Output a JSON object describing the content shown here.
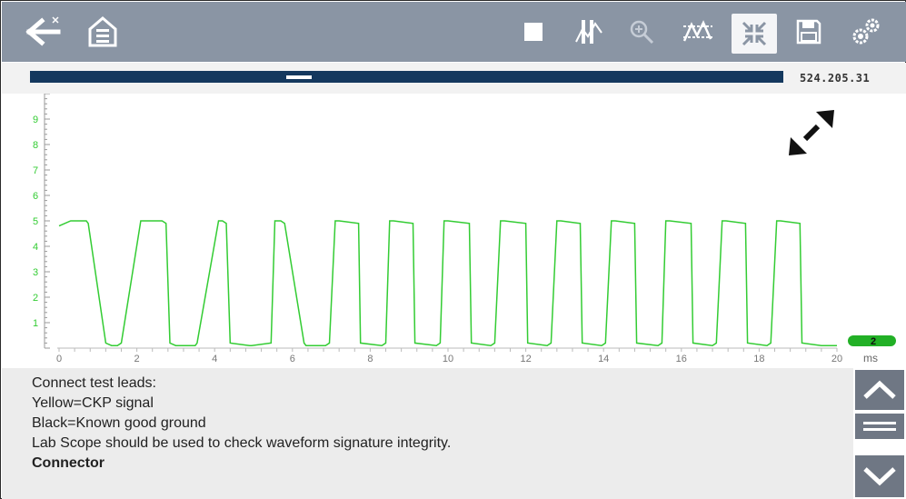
{
  "toolbar": {
    "back_icon": "back-arrow-icon",
    "home_icon": "home-icon",
    "stop_icon": "stop-icon",
    "pause_icon": "pause-trace-icon",
    "zoom_icon": "zoom-icon",
    "trace_settings_icon": "trace-settings-icon",
    "fullscreen_icon": "collapse-arrows-icon",
    "save_icon": "save-icon",
    "settings_icon": "gears-icon"
  },
  "position_bar": {
    "readout": "524.205.31"
  },
  "graph": {
    "expand_icon": "expand-arrows-icon",
    "trace_badge": "2",
    "x_unit": "ms",
    "trace_color": "#33cc33"
  },
  "chart_data": {
    "type": "line",
    "series": [
      {
        "x": [
          0,
          0.3,
          0.7,
          0.75,
          1.2,
          1.35,
          1.5,
          1.6,
          2.1,
          2.15,
          2.65,
          2.75,
          2.85,
          3.0,
          3.5,
          3.55,
          4.1,
          4.2,
          4.3,
          4.4,
          4.9,
          4.95,
          5.45,
          5.55,
          5.7,
          5.8,
          6.3,
          6.35,
          6.85,
          6.95,
          7.1,
          7.2,
          7.7,
          7.75,
          8.3,
          8.4,
          8.5,
          8.6,
          9.1,
          9.15,
          9.7,
          9.8,
          9.9,
          10.0,
          10.55,
          10.6,
          11.1,
          11.2,
          11.35,
          11.45,
          12.0,
          12.05,
          12.55,
          12.65,
          12.8,
          12.9,
          13.4,
          13.45,
          13.95,
          14.05,
          14.2,
          14.3,
          14.8,
          14.85,
          15.4,
          15.5,
          15.6,
          15.7,
          16.25,
          16.3,
          16.8,
          16.9,
          17.05,
          17.15,
          17.65,
          17.7,
          18.2,
          18.3,
          18.45,
          18.55,
          19.05,
          19.1,
          19.6,
          19.7,
          20.0
        ],
        "y": [
          4.8,
          5.0,
          5.0,
          4.9,
          0.2,
          0.1,
          0.1,
          0.2,
          5.0,
          5.0,
          5.0,
          4.9,
          0.2,
          0.1,
          0.1,
          0.2,
          5.0,
          5.0,
          4.9,
          0.2,
          0.1,
          0.1,
          0.2,
          5.0,
          5.0,
          4.9,
          0.2,
          0.1,
          0.1,
          0.2,
          5.0,
          5.0,
          4.9,
          0.2,
          0.1,
          0.2,
          5.0,
          5.0,
          4.9,
          0.2,
          0.1,
          0.2,
          5.0,
          5.0,
          4.9,
          0.2,
          0.1,
          0.2,
          5.0,
          5.0,
          4.9,
          0.2,
          0.1,
          0.2,
          5.0,
          5.0,
          4.9,
          0.2,
          0.1,
          0.2,
          5.0,
          5.0,
          4.9,
          0.2,
          0.1,
          0.2,
          5.0,
          5.0,
          4.9,
          0.2,
          0.1,
          0.2,
          5.0,
          5.0,
          4.9,
          0.2,
          0.1,
          0.2,
          5.0,
          5.0,
          4.9,
          0.2,
          0.1,
          0.1,
          0.1
        ]
      }
    ],
    "x_ticks": [
      "0",
      "2",
      "4",
      "6",
      "8",
      "10",
      "12",
      "14",
      "16",
      "18",
      "20"
    ],
    "y_ticks": [
      "1",
      "2",
      "3",
      "4",
      "5",
      "6",
      "7",
      "8",
      "9"
    ],
    "xlim": [
      0,
      20
    ],
    "ylim": [
      0,
      10
    ],
    "grid": false
  },
  "info": {
    "lines": [
      "Connect test leads:",
      "Yellow=CKP signal",
      "Black=Known good ground",
      "Lab Scope should be used to check waveform signature integrity.",
      "Connector"
    ]
  },
  "scroll": {
    "up_icon": "chevron-up-icon",
    "middle_icon": "scroll-handle-icon",
    "down_icon": "chevron-down-icon"
  }
}
